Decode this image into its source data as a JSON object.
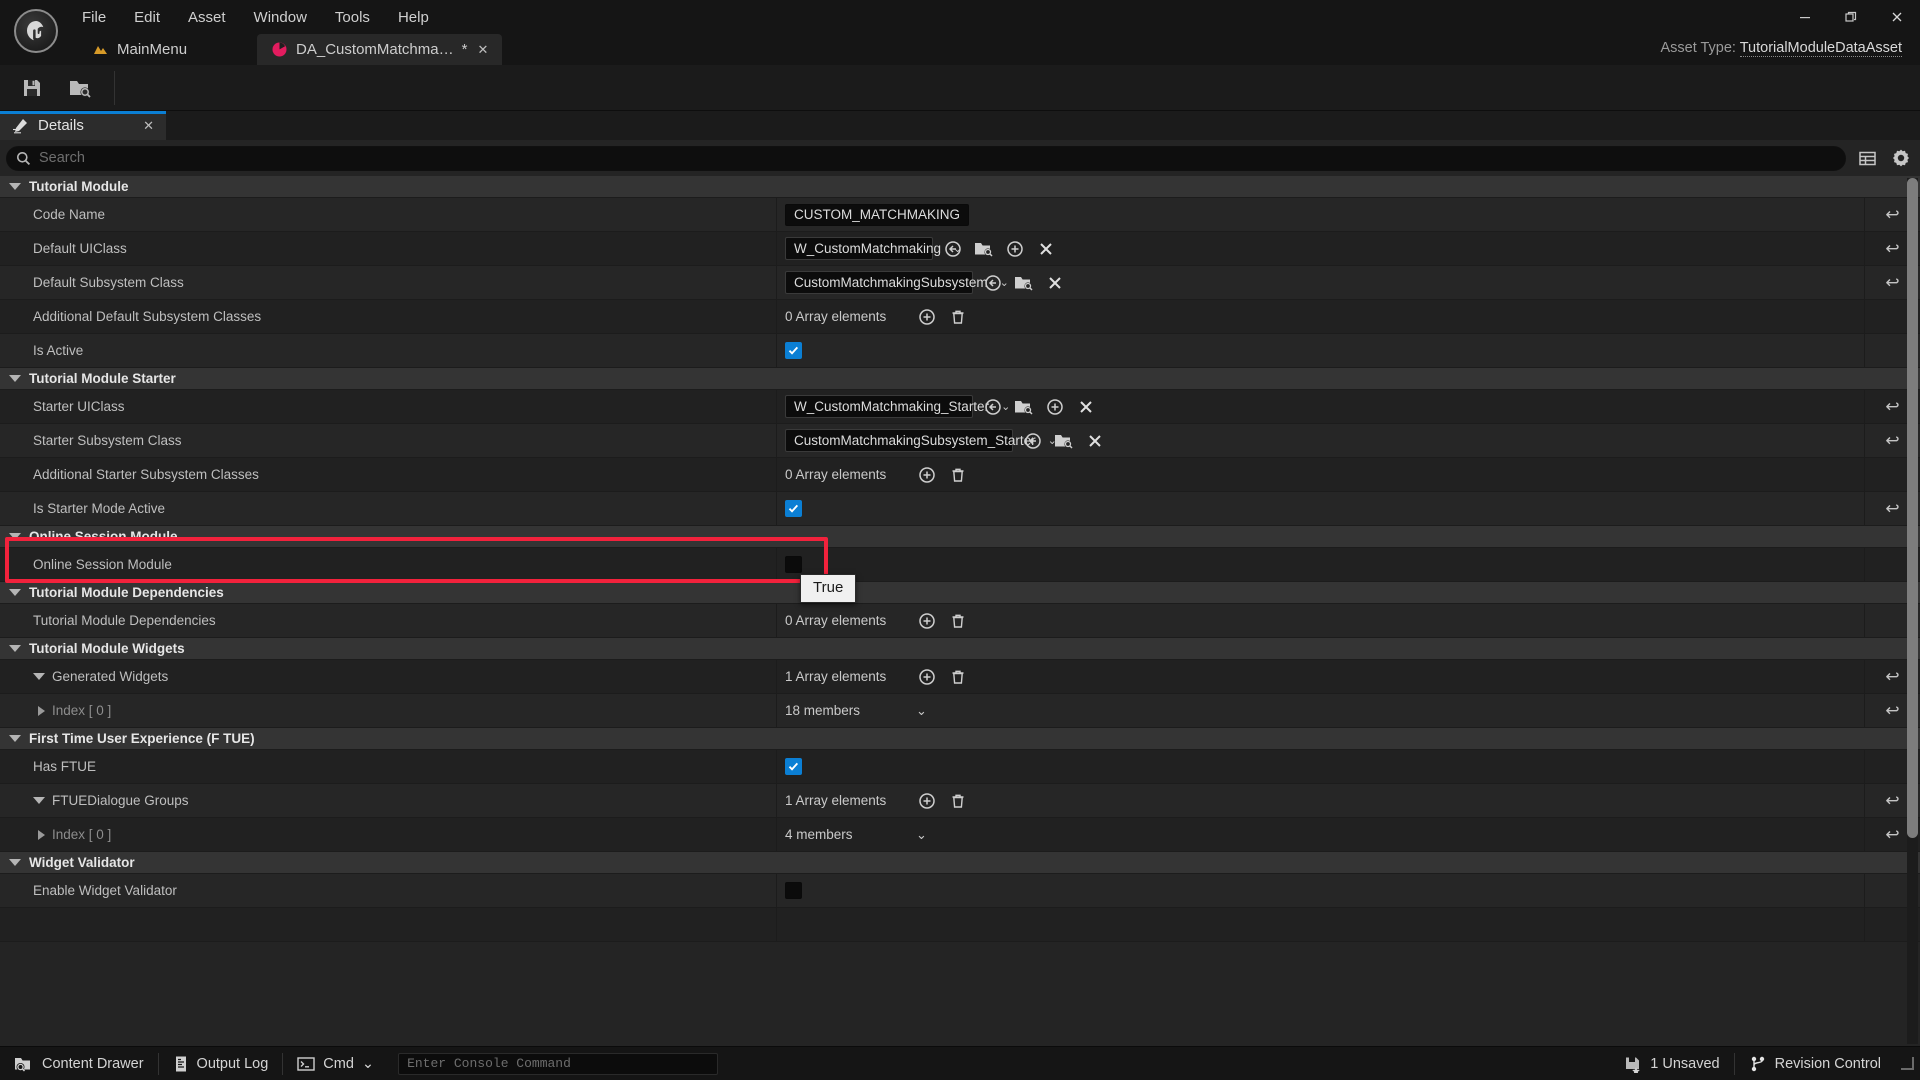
{
  "window": {
    "menus": [
      "File",
      "Edit",
      "Asset",
      "Window",
      "Tools",
      "Help"
    ],
    "minimize_label": "—",
    "maximize_label": "❐",
    "close_label": "✕"
  },
  "tabs": {
    "main_tab": "MainMenu",
    "asset_tab": "DA_CustomMatchma…",
    "asset_tab_dirty": "*",
    "asset_tab_close": "✕",
    "asset_type_label": "Asset Type:",
    "asset_type_value": "TutorialModuleDataAsset"
  },
  "asset_toolbar": {
    "save_icon": "save-icon",
    "browse_icon": "browse-content-icon"
  },
  "details_panel": {
    "tab_label": "Details",
    "tab_close": "✕",
    "accent_color": "#0b7fd4",
    "search": {
      "placeholder": "Search",
      "icon": "search-icon"
    },
    "view_options_icon": "table-view-icon",
    "settings_icon": "gear-icon"
  },
  "sections": [
    {
      "title": "Tutorial Module",
      "rows": [
        {
          "name": "Code Name",
          "widget": "text",
          "value": "CUSTOM_MATCHMAKING",
          "reset": true
        },
        {
          "name": "Default UIClass",
          "widget": "combo",
          "value": "W_CustomMatchmaking",
          "combo_width": 148,
          "buttons": [
            "browse-back-icon",
            "browse-content-icon",
            "add-icon",
            "clear-icon"
          ],
          "reset": true
        },
        {
          "name": "Default Subsystem Class",
          "widget": "combo",
          "value": "CustomMatchmakingSubsystem",
          "combo_width": 188,
          "buttons": [
            "browse-back-icon",
            "browse-content-icon",
            "clear-icon"
          ],
          "reset": true
        },
        {
          "name": "Additional Default Subsystem Classes",
          "widget": "array",
          "value": "0 Array elements",
          "buttons": [
            "add-icon",
            "delete-icon"
          ],
          "reset": false
        },
        {
          "name": "Is Active",
          "widget": "checkbox",
          "checked": true,
          "reset": false
        }
      ]
    },
    {
      "title": "Tutorial Module Starter",
      "rows": [
        {
          "name": "Starter UIClass",
          "widget": "combo",
          "value": "W_CustomMatchmaking_Starter",
          "combo_width": 188,
          "buttons": [
            "browse-back-icon",
            "browse-content-icon",
            "add-icon",
            "clear-icon"
          ],
          "reset": true
        },
        {
          "name": "Starter Subsystem Class",
          "widget": "combo",
          "value": "CustomMatchmakingSubsystem_Starter",
          "combo_width": 228,
          "buttons": [
            "browse-back-icon",
            "browse-content-icon",
            "clear-icon"
          ],
          "reset": true
        },
        {
          "name": "Additional Starter Subsystem Classes",
          "widget": "array",
          "value": "0 Array elements",
          "buttons": [
            "add-icon",
            "delete-icon"
          ],
          "reset": false
        },
        {
          "name": "Is Starter Mode Active",
          "widget": "checkbox",
          "checked": true,
          "reset": true,
          "highlighted": true
        }
      ]
    },
    {
      "title": "Online Session Module",
      "rows": [
        {
          "name": "Online Session Module",
          "widget": "checkbox",
          "checked": false,
          "reset": false
        }
      ]
    },
    {
      "title": "Tutorial Module Dependencies",
      "rows": [
        {
          "name": "Tutorial Module Dependencies",
          "widget": "array",
          "value": "0 Array elements",
          "buttons": [
            "add-icon",
            "delete-icon"
          ],
          "reset": false
        }
      ]
    },
    {
      "title": "Tutorial Module Widgets",
      "rows": [
        {
          "name": "Generated Widgets",
          "widget": "array",
          "value": "1 Array elements",
          "buttons": [
            "add-icon",
            "delete-icon"
          ],
          "reset": true,
          "expander": "down"
        },
        {
          "name": "Index [ 0 ]",
          "widget": "members",
          "value": "18 members",
          "reset": true,
          "expander": "right",
          "indent": 2,
          "dim": true
        }
      ]
    },
    {
      "title": "First Time User Experience (F TUE)",
      "rows": [
        {
          "name": "Has FTUE",
          "widget": "checkbox",
          "checked": true,
          "reset": false
        },
        {
          "name": "FTUEDialogue Groups",
          "widget": "array",
          "value": "1 Array elements",
          "buttons": [
            "add-icon",
            "delete-icon"
          ],
          "reset": true,
          "expander": "down"
        },
        {
          "name": "Index [ 0 ]",
          "widget": "members",
          "value": "4 members",
          "reset": true,
          "expander": "right",
          "indent": 2,
          "dim": true
        }
      ]
    },
    {
      "title": "Widget Validator",
      "rows": [
        {
          "name": "Enable Widget Validator",
          "widget": "checkbox",
          "checked": false,
          "reset": false
        }
      ]
    }
  ],
  "tooltip": {
    "text": "True"
  },
  "highlight": {
    "color": "#f2223c"
  },
  "statusbar": {
    "content_drawer": "Content Drawer",
    "output_log": "Output Log",
    "cmd_label": "Cmd",
    "cmd_caret": "⌄",
    "console_placeholder": "Enter Console Command",
    "unsaved": "1 Unsaved",
    "revision_control": "Revision Control"
  }
}
